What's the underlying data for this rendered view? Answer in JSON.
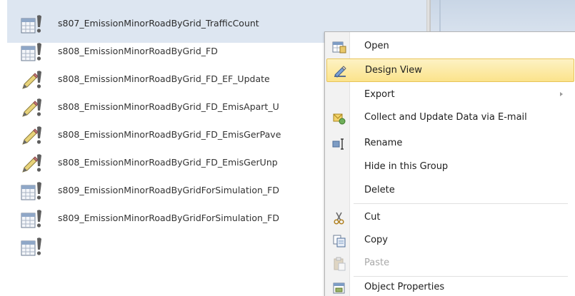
{
  "nav_pane": {
    "items": [
      {
        "label": "s807_EmissionMinorRoadByGrid_TrafficCount",
        "icon": "table-query-icon",
        "selected": true
      },
      {
        "label": "s808_EmissionMinorRoadByGrid_FD",
        "icon": "table-query-icon",
        "selected": false
      },
      {
        "label": "s808_EmissionMinorRoadByGrid_FD_EF_Update",
        "icon": "update-query-icon",
        "selected": false
      },
      {
        "label": "s808_EmissionMinorRoadByGrid_FD_EmisApart_U",
        "icon": "update-query-icon",
        "selected": false
      },
      {
        "label": "s808_EmissionMinorRoadByGrid_FD_EmisGerPave",
        "icon": "update-query-icon",
        "selected": false
      },
      {
        "label": "s808_EmissionMinorRoadByGrid_FD_EmisGerUnp",
        "icon": "update-query-icon",
        "selected": false
      },
      {
        "label": "s809_EmissionMinorRoadByGridForSimulation_FD",
        "icon": "table-query-icon",
        "selected": false
      },
      {
        "label": "s809_EmissionMinorRoadByGridForSimulation_FD",
        "icon": "table-query-icon",
        "selected": false
      },
      {
        "label": "",
        "icon": "table-query-icon",
        "selected": false
      }
    ]
  },
  "context_menu": {
    "items": [
      {
        "label": "Open",
        "icon": "open-icon",
        "disabled": false,
        "hover": false
      },
      {
        "label": "Design View",
        "icon": "design-view-icon",
        "disabled": false,
        "hover": true
      },
      {
        "label": "Export",
        "icon": "",
        "disabled": false,
        "hover": false,
        "submenu": true
      },
      {
        "label": "Collect and Update Data via E-mail",
        "icon": "collect-data-icon",
        "disabled": false,
        "hover": false
      },
      {
        "label": "Rename",
        "icon": "rename-icon",
        "disabled": false,
        "hover": false
      },
      {
        "label": "Hide in this Group",
        "icon": "",
        "disabled": false,
        "hover": false
      },
      {
        "label": "Delete",
        "icon": "",
        "disabled": false,
        "hover": false
      },
      {
        "label": "Cut",
        "icon": "cut-icon",
        "disabled": false,
        "hover": false
      },
      {
        "label": "Copy",
        "icon": "copy-icon",
        "disabled": false,
        "hover": false
      },
      {
        "label": "Paste",
        "icon": "paste-icon",
        "disabled": true,
        "hover": false
      },
      {
        "label": "Object Properties",
        "icon": "object-properties-icon",
        "disabled": false,
        "hover": false
      }
    ]
  },
  "colors": {
    "hover_bg": "#fbe38b",
    "hover_border": "#e8c45a",
    "selected_row": "#dde6f1",
    "disabled_text": "#a8a8a8"
  }
}
